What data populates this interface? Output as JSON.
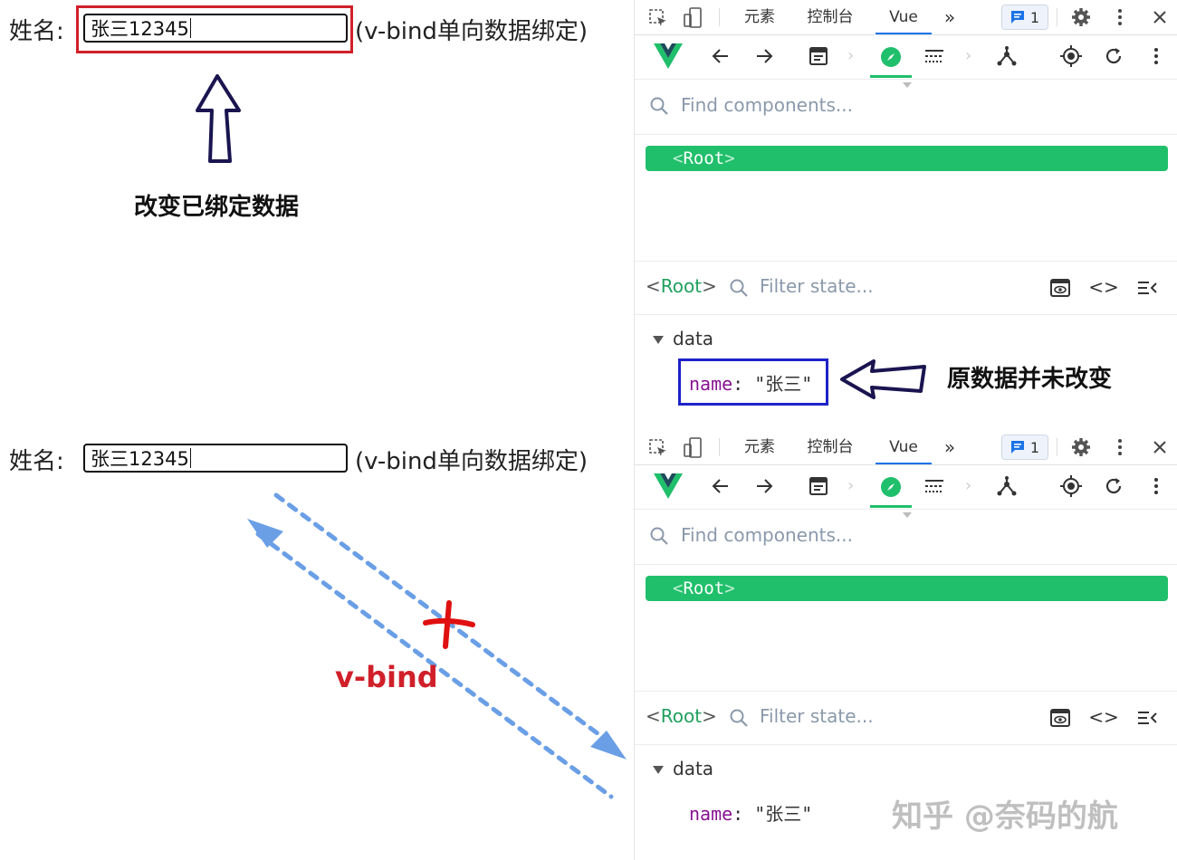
{
  "panels": [
    {
      "form": {
        "label": "姓名:",
        "input_value": "张三12345",
        "note": "(v-bind单向数据绑定)"
      },
      "annotation": "改变已绑定数据",
      "devtools": {
        "tabs": [
          "元素",
          "控制台",
          "Vue"
        ],
        "active_tab": "Vue",
        "more_tabs": "»",
        "message_count": "1",
        "search_placeholder": "Find components...",
        "root_component": "Root",
        "selected_component": "Root",
        "filter_placeholder": "Filter state...",
        "data_section": "data",
        "data_key": "name",
        "data_value": "\"张三\"",
        "annotation": "原数据并未改变"
      }
    },
    {
      "form": {
        "label": "姓名:",
        "input_value": "张三12345",
        "note": "(v-bind单向数据绑定)"
      },
      "annotation": "v-bind",
      "devtools": {
        "tabs": [
          "元素",
          "控制台",
          "Vue"
        ],
        "active_tab": "Vue",
        "more_tabs": "»",
        "message_count": "1",
        "search_placeholder": "Find components...",
        "root_component": "Root",
        "selected_component": "Root",
        "filter_placeholder": "Filter state...",
        "data_section": "data",
        "data_key": "name",
        "data_value": "\"张三\""
      }
    }
  ],
  "watermark": "知乎 @奈码的航",
  "colors": {
    "vue_green": "#20bf6b",
    "highlight_red": "#d0202a",
    "highlight_blue": "#1e22c8",
    "arrow_outline": "#1a1550",
    "dashed_arrow": "#6a9fe6",
    "cross_red": "#e01010"
  }
}
